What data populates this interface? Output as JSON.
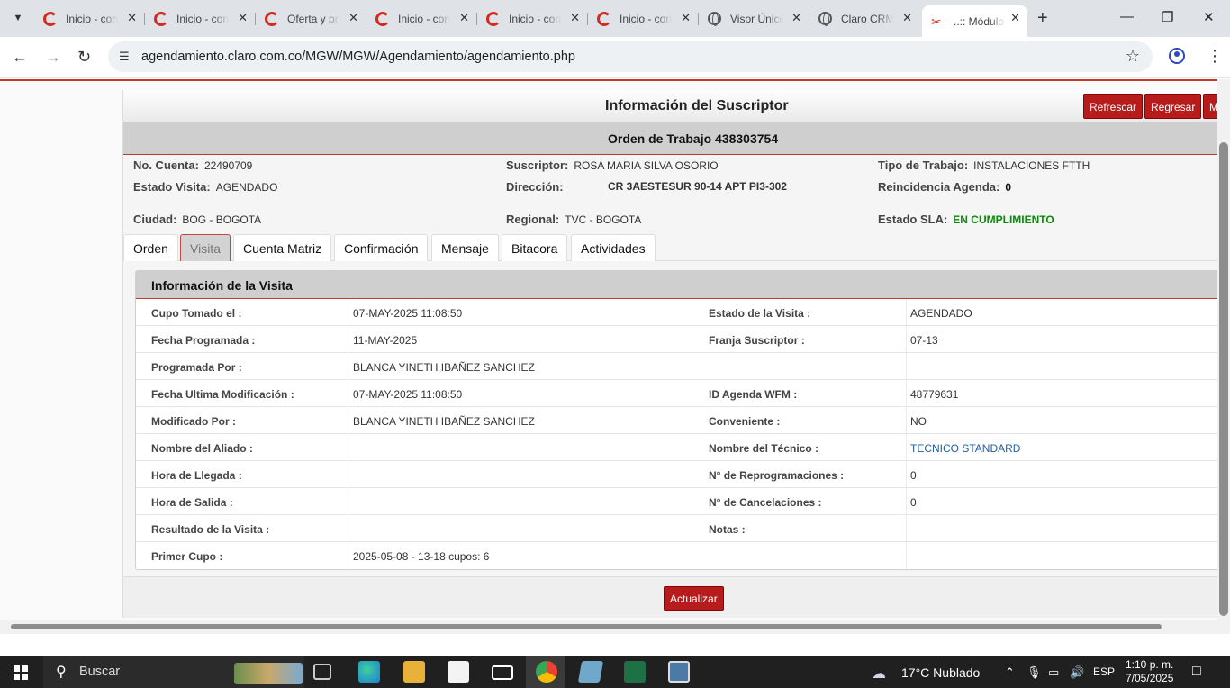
{
  "browser": {
    "tabs": [
      {
        "title": "Inicio - conecta",
        "icon": "claro-icon"
      },
      {
        "title": "Inicio - conecta",
        "icon": "claro-icon"
      },
      {
        "title": "Oferta y precios",
        "icon": "claro-icon"
      },
      {
        "title": "Inicio - conecta",
        "icon": "claro-icon"
      },
      {
        "title": "Inicio - conecta",
        "icon": "claro-icon"
      },
      {
        "title": "Inicio - conecta",
        "icon": "claro-icon"
      },
      {
        "title": "Visor Único",
        "icon": "globe-icon"
      },
      {
        "title": "Claro CRM",
        "icon": "globe-icon"
      },
      {
        "title": "..:: Módulo de",
        "icon": "scissors-icon",
        "active": true
      }
    ],
    "url": "agendamiento.claro.com.co/MGW/MGW/Agendamiento/agendamiento.php"
  },
  "page": {
    "title": "Información del Suscriptor",
    "buttons": {
      "refresh": "Refrescar",
      "back": "Regresar",
      "more": "M"
    },
    "order": "Orden de Trabajo 438303754",
    "summary": {
      "cuenta_label": "No. Cuenta:",
      "cuenta": "22490709",
      "suscriptor_label": "Suscriptor:",
      "suscriptor": "ROSA MARIA SILVA OSORIO",
      "tipo_label": "Tipo de Trabajo:",
      "tipo": "INSTALACIONES FTTH",
      "estado_label": "Estado Visita:",
      "estado": "AGENDADO",
      "direccion_label": "Dirección:",
      "direccion": "CR 3AESTESUR 90-14 APT PI3-302",
      "reincidencia_label": "Reincidencia Agenda:",
      "reincidencia": "0",
      "ciudad_label": "Ciudad:",
      "ciudad": "BOG - BOGOTA",
      "regional_label": "Regional:",
      "regional": "TVC - BOGOTA",
      "sla_label": "Estado SLA:",
      "sla": "EN CUMPLIMIENTO"
    },
    "tabs": [
      "Orden",
      "Visita",
      "Cuenta Matriz",
      "Confirmación",
      "Mensaje",
      "Bitacora",
      "Actividades"
    ],
    "selected_tab": "Visita",
    "visit": {
      "header": "Información de la Visita",
      "rows": [
        {
          "l1": "Cupo Tomado el :",
          "v1": "07-MAY-2025 11:08:50",
          "l2": "Estado de la Visita :",
          "v2": "AGENDADO"
        },
        {
          "l1": "Fecha Programada :",
          "v1": "11-MAY-2025",
          "l2": "Franja Suscriptor :",
          "v2": "07-13"
        },
        {
          "l1": "Programada Por :",
          "v1": "BLANCA YINETH IBAÑEZ SANCHEZ",
          "l2": "",
          "v2": ""
        },
        {
          "l1": "Fecha Ultima Modificación :",
          "v1": "07-MAY-2025 11:08:50",
          "l2": "ID Agenda WFM :",
          "v2": "48779631"
        },
        {
          "l1": "Modificado Por :",
          "v1": "BLANCA YINETH IBAÑEZ SANCHEZ",
          "l2": "Conveniente :",
          "v2": "NO"
        },
        {
          "l1": "Nombre del Aliado :",
          "v1": "",
          "l2": "Nombre del Técnico :",
          "v2": "TECNICO STANDARD"
        },
        {
          "l1": "Hora de Llegada :",
          "v1": "",
          "l2": "N° de Reprogramaciones :",
          "v2": "0"
        },
        {
          "l1": "Hora de Salida :",
          "v1": "",
          "l2": "N° de Cancelaciones :",
          "v2": "0"
        },
        {
          "l1": "Resultado de la Visita :",
          "v1": "",
          "l2": "Notas :",
          "v2": ""
        },
        {
          "l1": "Primer Cupo :",
          "v1": "2025-05-08 - 13-18 cupos: 6",
          "l2": "",
          "v2": ""
        }
      ]
    },
    "update_button": "Actualizar"
  },
  "taskbar": {
    "search": "Buscar",
    "weather": "17°C  Nublado",
    "lang": "ESP",
    "time": "1:10 p. m.",
    "date": "7/05/2025"
  },
  "colors": {
    "brand_red": "#b71c1c",
    "sla_green": "#0a8a0a",
    "tech_blue": "#1f5e9e"
  }
}
